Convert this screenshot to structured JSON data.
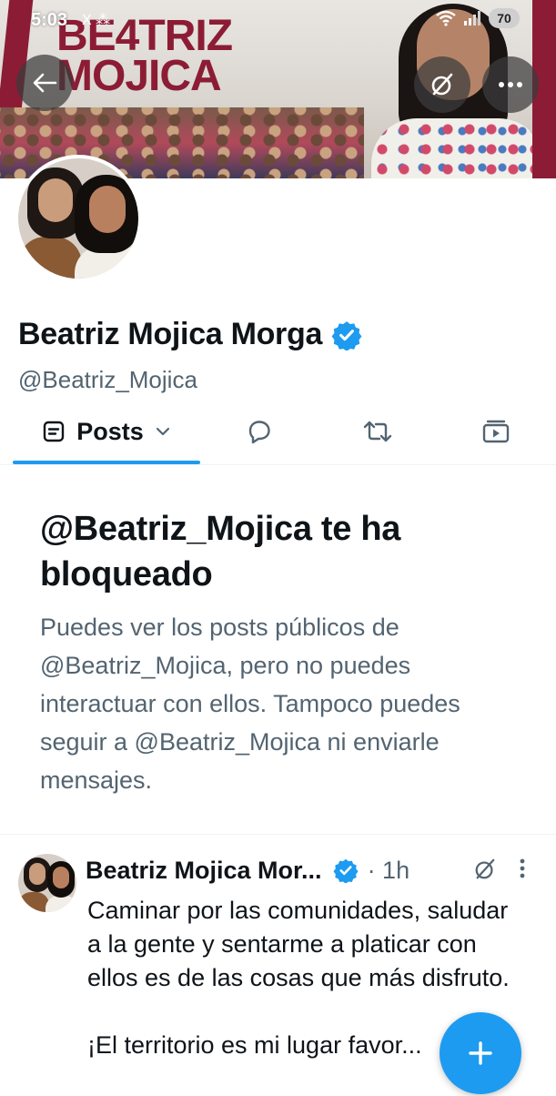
{
  "status_bar": {
    "time": "5:03",
    "notification_icons": "X ⁂",
    "battery": "70"
  },
  "banner": {
    "title_line1": "BE4TRIZ",
    "title_line2": "MOJICA"
  },
  "profile": {
    "display_name": "Beatriz Mojica Morga",
    "handle": "@Beatriz_Mojica",
    "verified": true
  },
  "tabs": {
    "posts_label": "Posts"
  },
  "blocked_notice": {
    "title": "@Beatriz_Mojica te ha bloqueado",
    "body": "Puedes ver los posts públicos de @Beatriz_Mojica, pero no puedes interactuar con ellos. Tampoco puedes seguir a @Beatriz_Mojica ni enviarle mensajes."
  },
  "post": {
    "author": "Beatriz Mojica Mor...",
    "time": "· 1h",
    "text_paragraph1": "Caminar por las comunidades, saludar a la gente y sentarme a platicar con ellos es de las cosas que más disfruto.",
    "text_paragraph2": "¡El territorio es mi lugar favor..."
  },
  "colors": {
    "accent": "#1d9bf0",
    "text_primary": "#0f1419",
    "text_secondary": "#536471",
    "brand_banner": "#8c1c35"
  },
  "icons": [
    "back-arrow-icon",
    "grok-icon",
    "more-horizontal-icon",
    "verified-badge-icon",
    "posts-list-icon",
    "chevron-down-icon",
    "reply-bubble-icon",
    "repost-icon",
    "media-icon",
    "more-vertical-icon",
    "compose-plus-icon"
  ]
}
